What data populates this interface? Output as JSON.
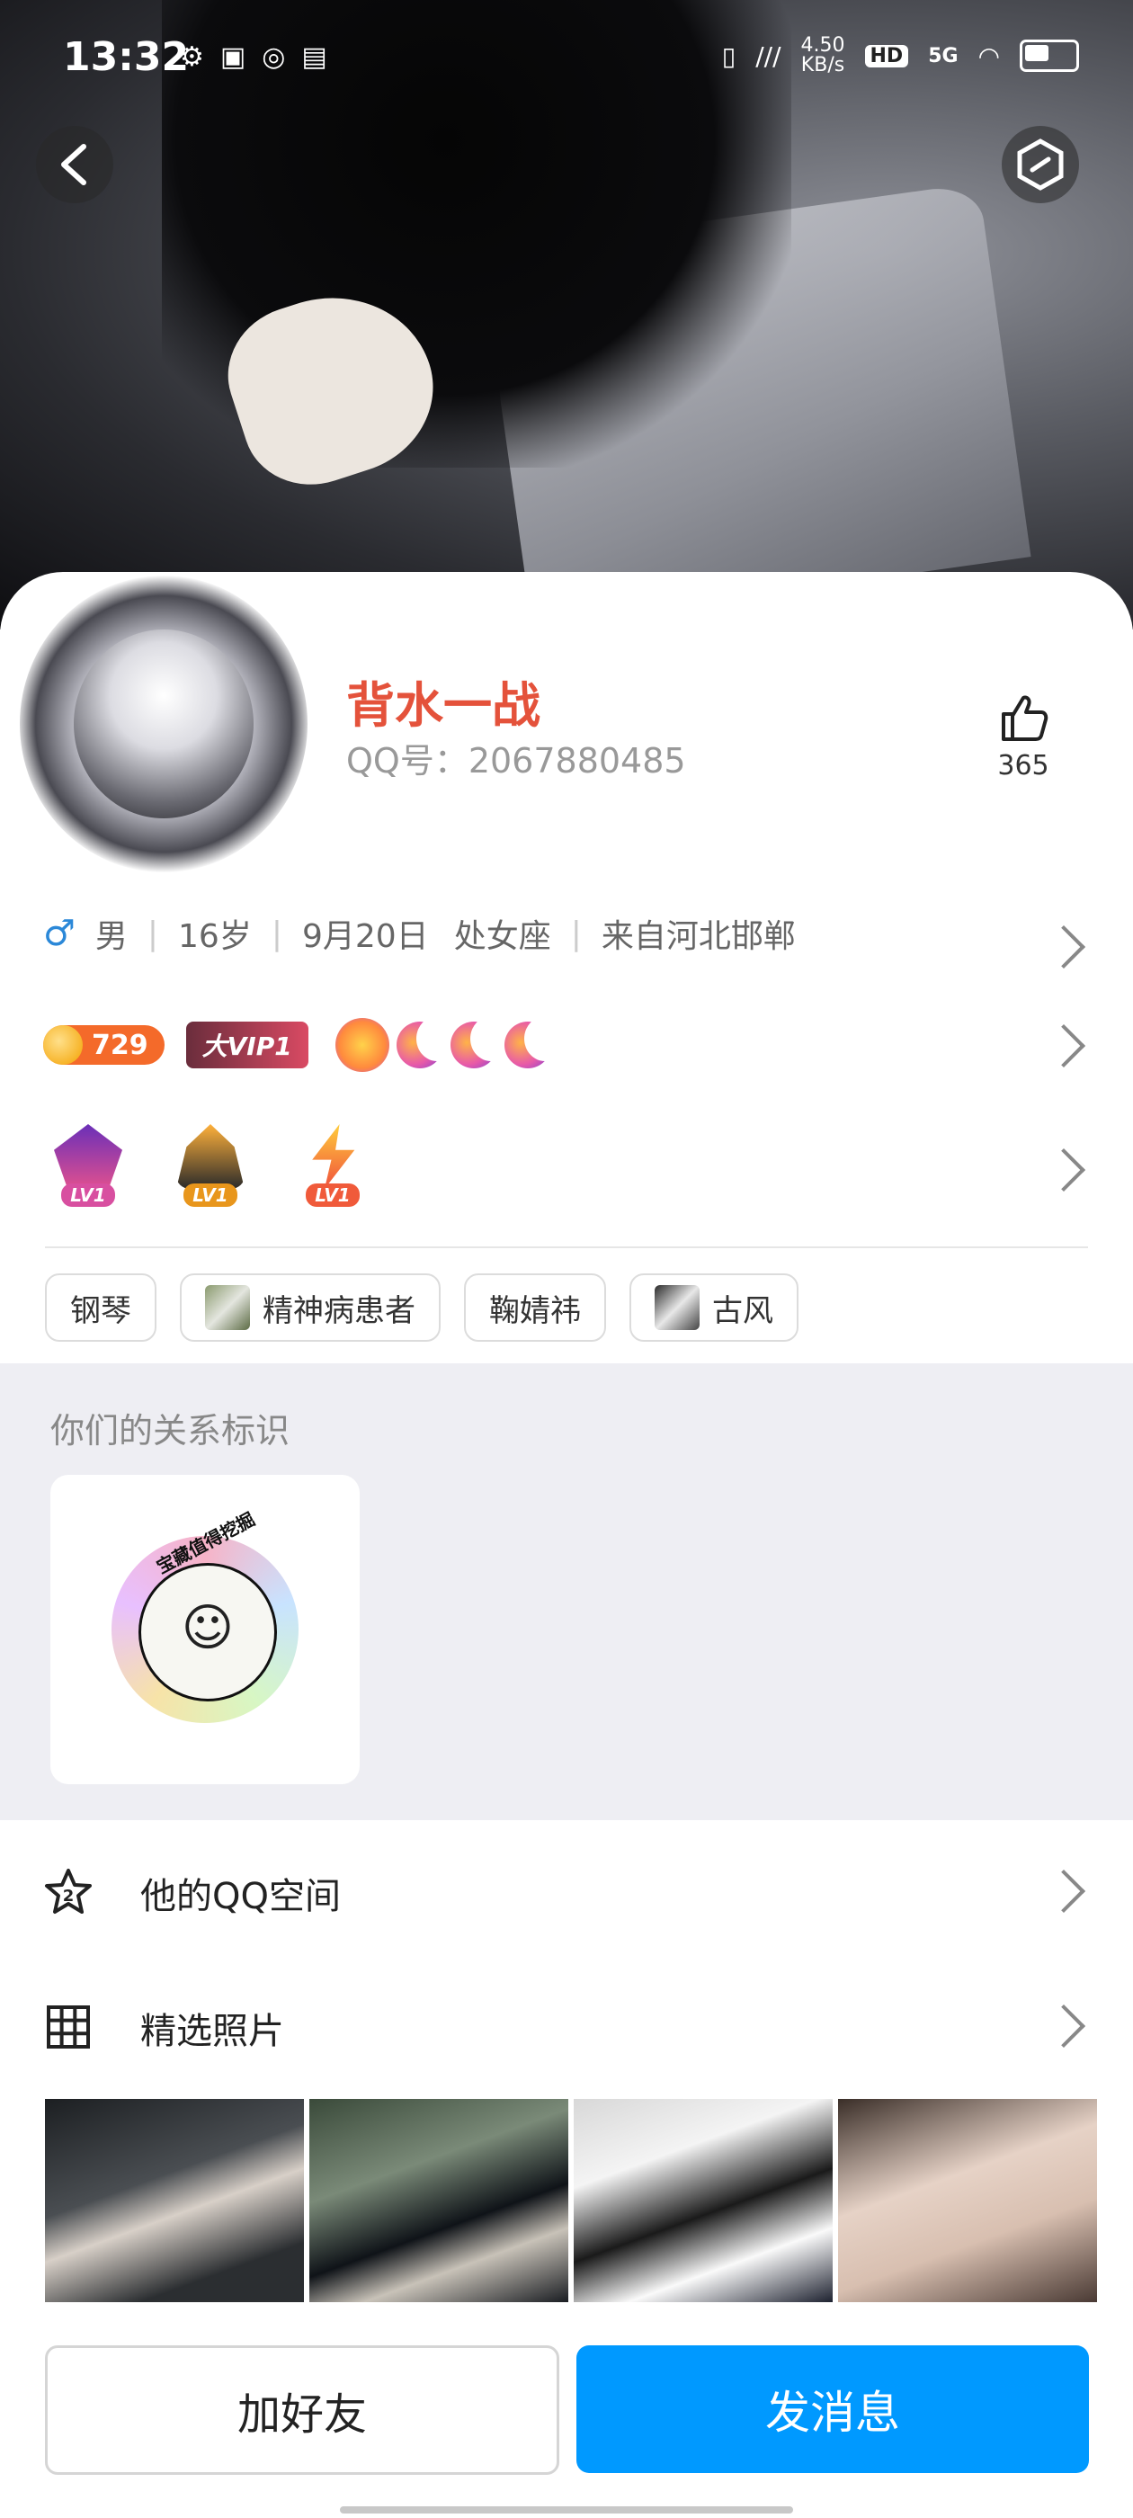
{
  "status_bar": {
    "time": "13:32",
    "net_speed": "4.50\nKB/s",
    "hd": "HD",
    "signal": "5G"
  },
  "profile": {
    "nickname": "背水一战",
    "qq_number": "QQ号：2067880485",
    "like_count": "365"
  },
  "info": {
    "gender_symbol": "♂",
    "gender": "男",
    "age": "16岁",
    "birthday": "9月20日",
    "constellation": "处女座",
    "location": "来自河北邯郸"
  },
  "badges": {
    "coin_value": "729",
    "vip_label": "大VIP1",
    "level_tags": [
      "LV1",
      "LV1",
      "LV1"
    ]
  },
  "tags": [
    {
      "label": "钢琴"
    },
    {
      "label": "精神病患者"
    },
    {
      "label": "鞠婧祎"
    },
    {
      "label": "古风"
    }
  ],
  "relationship": {
    "title": "你们的关系标识",
    "sticker_text": "宝藏值得挖掘"
  },
  "menu": {
    "qzone_label": "他的QQ空间",
    "photos_label": "精选照片"
  },
  "actions": {
    "add_friend": "加好友",
    "send_message": "发消息"
  },
  "colors": {
    "nickname": "#e4523b",
    "primary_button": "#0099ff",
    "male_icon": "#2b88d8"
  }
}
